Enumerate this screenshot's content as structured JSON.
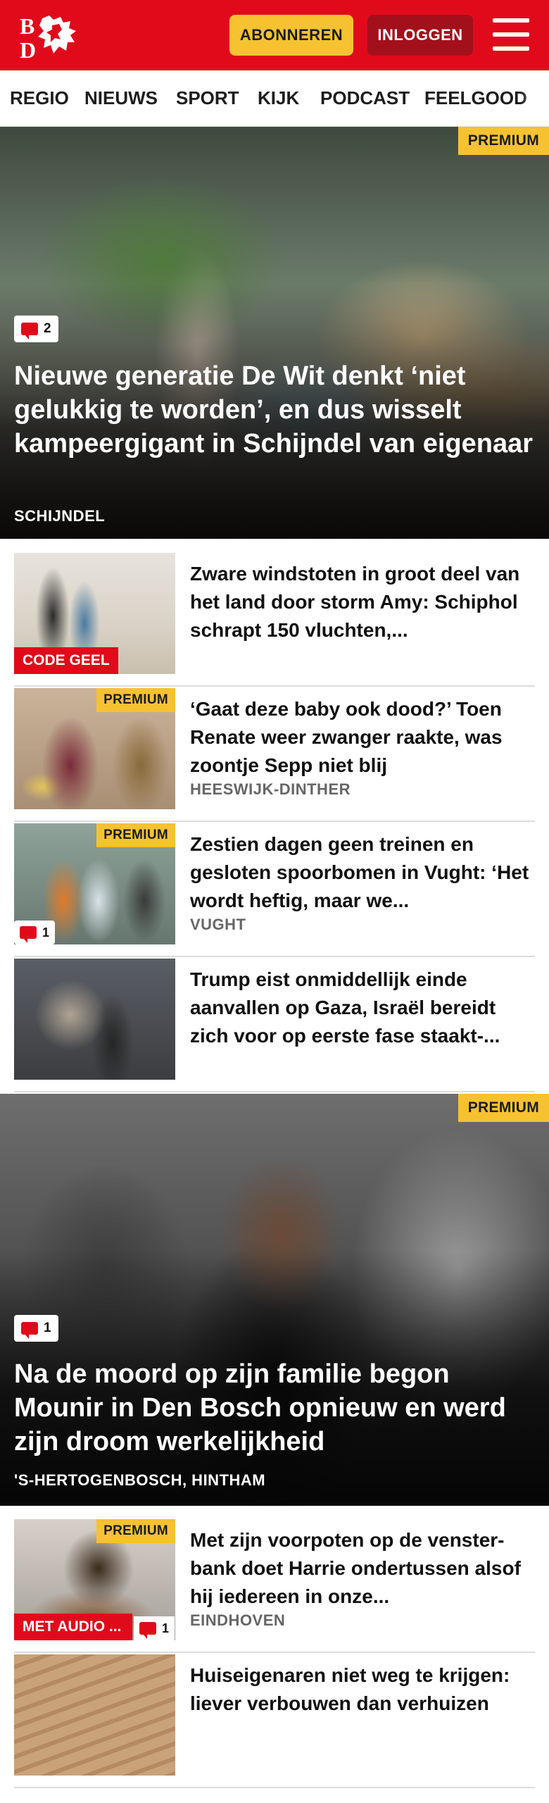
{
  "header": {
    "subscribe_label": "ABONNEREN",
    "login_label": "INLOGGEN",
    "logo_text_top": "B",
    "logo_text_bottom": "D"
  },
  "nav": {
    "items": [
      "REGIO",
      "NIEUWS",
      "SPORT",
      "KIJK",
      "PODCAST",
      "FEELGOOD"
    ]
  },
  "colors": {
    "brand_red": "#e10a1b",
    "premium_yellow": "#f6c232",
    "login_dark_red": "#a3101c"
  },
  "articles": [
    {
      "type": "hero",
      "premium": "PREMIUM",
      "comments": "2",
      "title": "Nieuwe generatie De Wit denkt ‘niet gelukkig te worden’, en dus wisselt kampeergigant in Schijndel van eigenaar",
      "location": "SCHIJNDEL"
    },
    {
      "type": "row",
      "label": "CODE GEEL",
      "title": "Zware windstoten in groot deel van het land door storm Amy: Schiphol schrapt 150 vluchten,...",
      "location": ""
    },
    {
      "type": "row",
      "premium": "PREMIUM",
      "title": "‘Gaat deze baby ook dood?’ Toen Renate weer zwanger raakte, was zoontje Sepp niet blij",
      "location": "HEESWIJK-DINTHER"
    },
    {
      "type": "row",
      "premium": "PREMIUM",
      "comments": "1",
      "title": "Zestien dagen geen treinen en gesloten spoorbomen in Vught: ‘Het wordt heftig, maar we...",
      "location": "VUGHT"
    },
    {
      "type": "row",
      "title": "Trump eist onmiddellijk einde aanvallen op Gaza, Israël bereidt zich voor op eerste fase staakt-...",
      "location": ""
    },
    {
      "type": "hero",
      "premium": "PREMIUM",
      "comments": "1",
      "title": "Na de moord op zijn familie begon Mounir in Den Bosch opnieuw en werd zijn droom werkelijkheid",
      "location": "'S-HERTOGENBOSCH, HINTHAM"
    },
    {
      "type": "row",
      "premium": "PREMIUM",
      "label": "MET AUDIO ...",
      "comments": "1",
      "title": "Met zijn voorpoten op de venster-bank doet Harrie ondertussen alsof hij iedereen in onze...",
      "location": "EINDHOVEN"
    },
    {
      "type": "row",
      "title": "Huiseigenaren niet weg te krijgen: liever verbouwen dan verhuizen",
      "location": ""
    }
  ]
}
